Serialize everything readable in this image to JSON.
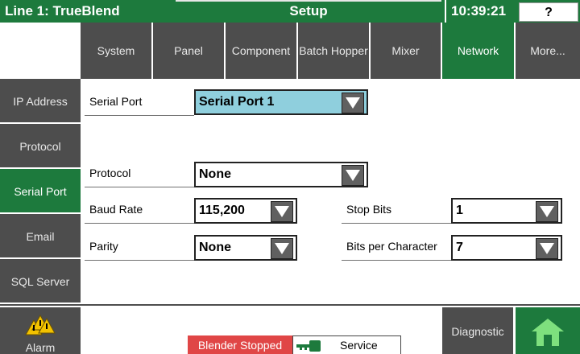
{
  "titlebar": {
    "line_name": "Line 1: TrueBlend",
    "screen_name": "Setup",
    "clock": "10:39:21",
    "help": "?"
  },
  "top_tabs": [
    {
      "label": "System",
      "active": false
    },
    {
      "label": "Panel",
      "active": false
    },
    {
      "label": "Component",
      "active": false
    },
    {
      "label": "Batch Hopper",
      "active": false
    },
    {
      "label": "Mixer",
      "active": false
    },
    {
      "label": "Network",
      "active": true
    },
    {
      "label": "More...",
      "active": false
    }
  ],
  "side_tabs": [
    {
      "label": "IP Address",
      "active": false
    },
    {
      "label": "Protocol",
      "active": false
    },
    {
      "label": "Serial Port",
      "active": true
    },
    {
      "label": "Email",
      "active": false
    },
    {
      "label": "SQL Server",
      "active": false
    }
  ],
  "form": {
    "serial_port_label": "Serial Port",
    "serial_port_value": "Serial Port 1",
    "protocol_label": "Protocol",
    "protocol_value": "None",
    "baud_rate_label": "Baud Rate",
    "baud_rate_value": "115,200",
    "parity_label": "Parity",
    "parity_value": "None",
    "stop_bits_label": "Stop Bits",
    "stop_bits_value": "1",
    "bits_per_char_label": "Bits per Character",
    "bits_per_char_value": "7"
  },
  "footer": {
    "alarm_label": "Alarm",
    "status_text": "Blender Stopped",
    "service_text": "Service",
    "diagnostic_label": "Diagnostic"
  },
  "colors": {
    "accent_green": "#1d7a3d",
    "tab_gray": "#4d4d4d",
    "selected_field": "#8fcfdd",
    "status_red": "#e04646"
  }
}
